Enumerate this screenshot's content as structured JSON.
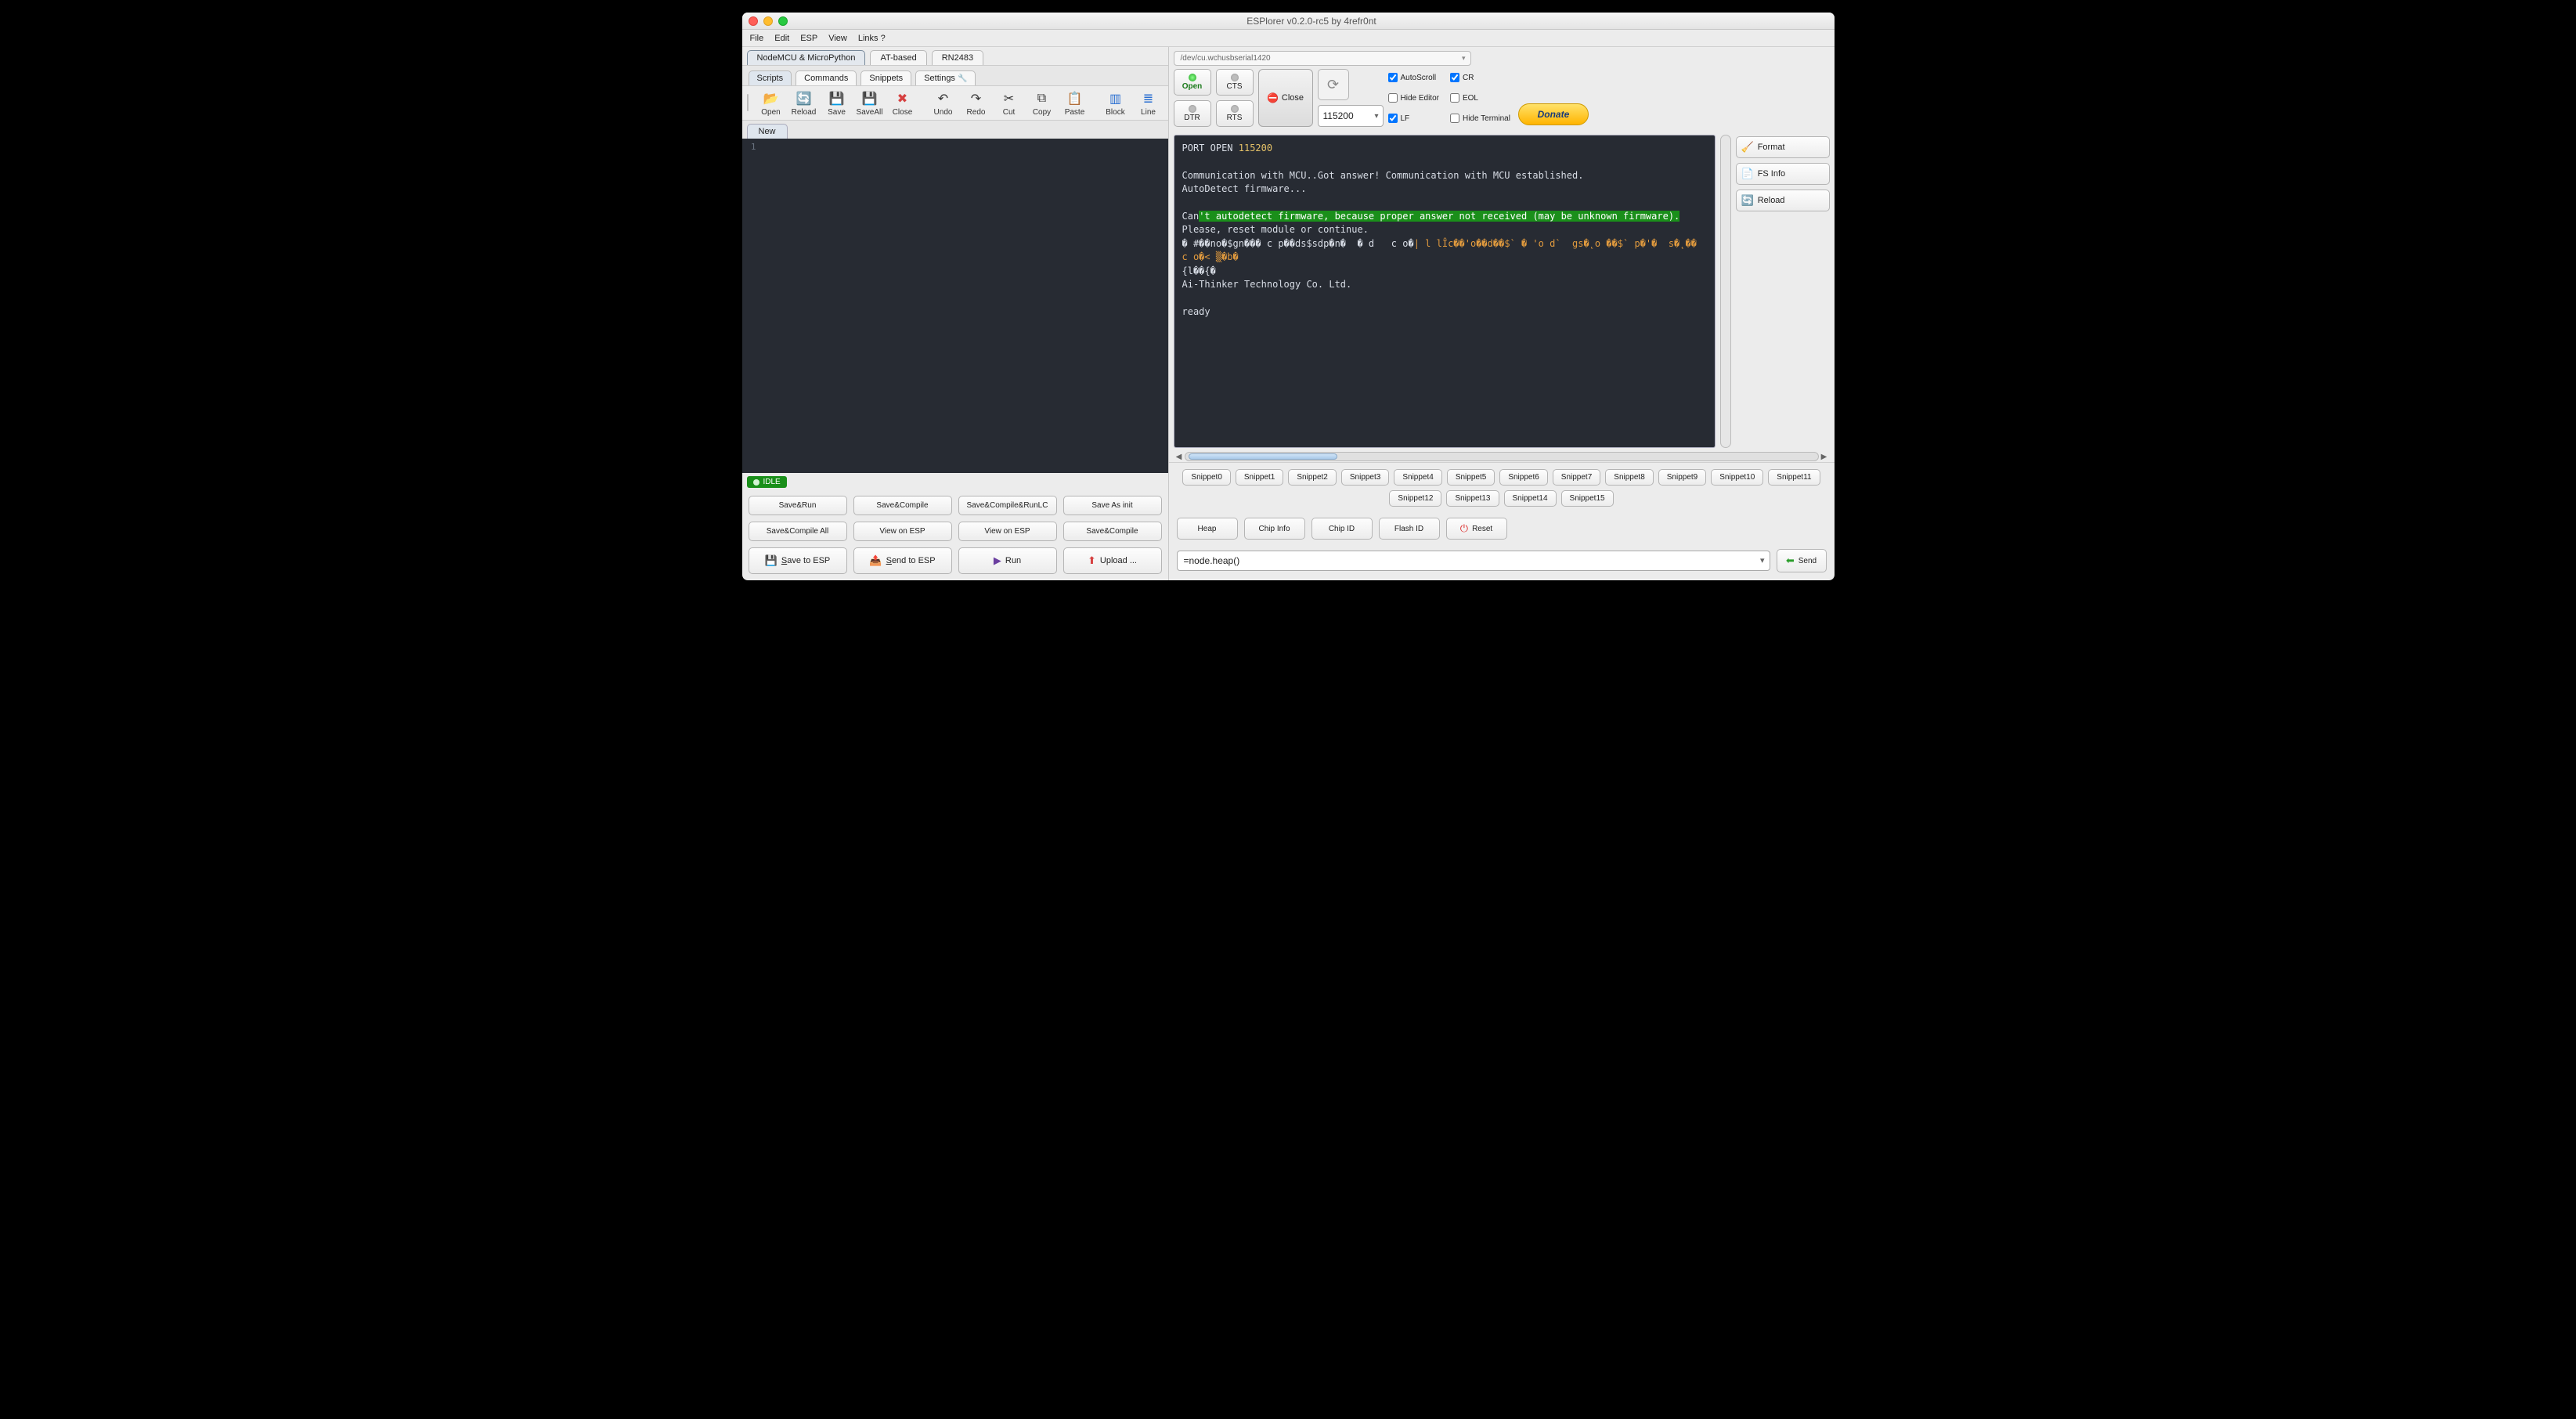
{
  "window": {
    "title": "ESPlorer v0.2.0-rc5 by 4refr0nt"
  },
  "menu": [
    "File",
    "Edit",
    "ESP",
    "View",
    "Links ?"
  ],
  "left": {
    "device_tabs": [
      "NodeMCU & MicroPython",
      "AT-based",
      "RN2483"
    ],
    "device_tab_active": 0,
    "mode_tabs": [
      "Scripts",
      "Commands",
      "Snippets",
      "Settings"
    ],
    "mode_tab_active": 0,
    "toolbar": [
      {
        "label": "Open",
        "icon": "📂",
        "cls": "ico-orange"
      },
      {
        "label": "Reload",
        "icon": "🔄",
        "cls": "ico-blue"
      },
      {
        "label": "Save",
        "icon": "💾",
        "cls": ""
      },
      {
        "label": "SaveAll",
        "icon": "💾",
        "cls": ""
      },
      {
        "label": "Close",
        "icon": "✖",
        "cls": "ico-red"
      },
      {
        "label": "Undo",
        "icon": "↶",
        "cls": ""
      },
      {
        "label": "Redo",
        "icon": "↷",
        "cls": ""
      },
      {
        "label": "Cut",
        "icon": "✂",
        "cls": ""
      },
      {
        "label": "Copy",
        "icon": "⧉",
        "cls": ""
      },
      {
        "label": "Paste",
        "icon": "📋",
        "cls": ""
      },
      {
        "label": "Block",
        "icon": "▥",
        "cls": "ico-blue"
      },
      {
        "label": "Line",
        "icon": "≣",
        "cls": "ico-blue"
      }
    ],
    "file_tab": "New",
    "gutter_line": "1",
    "status": "IDLE",
    "action_grid": [
      "Save&Run",
      "Save&Compile",
      "Save&Compile&RunLC",
      "Save As init",
      "Save&Compile All",
      "View on ESP",
      "View on ESP",
      "Save&Compile"
    ],
    "bottom_buttons": [
      {
        "label": "Save to ESP",
        "icon": "💾",
        "cls": "ico-green",
        "underline": "S"
      },
      {
        "label": "Send to ESP",
        "icon": "📤",
        "cls": "ico-green",
        "underline": "S"
      },
      {
        "label": "Run",
        "icon": "▶",
        "cls": "ico-purple"
      },
      {
        "label": "Upload ...",
        "icon": "⬆",
        "cls": "ico-red"
      }
    ]
  },
  "right": {
    "port": "/dev/cu.wchusbserial1420",
    "conn": {
      "open": "Open",
      "cts": "CTS",
      "dtr": "DTR",
      "rts": "RTS",
      "close": "Close"
    },
    "baud": "115200",
    "checks": {
      "autoscroll": {
        "label": "AutoScroll",
        "checked": true
      },
      "eol": {
        "label": "EOL",
        "checked": false
      },
      "cr": {
        "label": "CR",
        "checked": true
      },
      "lf": {
        "label": "LF",
        "checked": true
      },
      "hide_editor": {
        "label": "Hide Editor",
        "checked": false
      },
      "hide_terminal": {
        "label": "Hide Terminal",
        "checked": false
      }
    },
    "donate": "Donate",
    "terminal": {
      "port_open_prefix": "PORT OPEN ",
      "port_open_baud": "115200",
      "line_comm": "Communication with MCU..Got answer! Communication with MCU established.",
      "line_autodetect": "AutoDetect firmware...",
      "warn_prefix": "Can",
      "warn_hl": "'t autodetect firmware, because proper answer not received (may be unknown firmware).",
      "line_reset": "Please, reset module or continue.",
      "garbage_a": "� #��no�$gn��� c p��ds$sdp�n�  � d   c o�",
      "garbage_b": "| l lÎc��'o��d��$` � 'o d`  gs�˛o ��$` p�'�  s�˛��  c o�< ▒�b�",
      "garbage_c": "{l��{�",
      "vendor": "Ai-Thinker Technology Co. Ltd.",
      "ready": "ready"
    },
    "side_actions": [
      {
        "label": "Format",
        "icon": "🧹",
        "cls": "ico-orange"
      },
      {
        "label": "FS Info",
        "icon": "📄",
        "cls": "ico-orange"
      },
      {
        "label": "Reload",
        "icon": "🔄",
        "cls": "ico-blue"
      }
    ],
    "snippets_row1": [
      "Snippet0",
      "Snippet1",
      "Snippet2",
      "Snippet3",
      "Snippet4",
      "Snippet5",
      "Snippet6",
      "Snippet7",
      "Snippet8",
      "Snippet9",
      "Snippet10",
      "Snippet11",
      "Snippet12"
    ],
    "snippets_row2": [
      "Snippet13",
      "Snippet14",
      "Snippet15"
    ],
    "cmd_buttons": [
      "Heap",
      "Chip Info",
      "Chip ID",
      "Flash ID"
    ],
    "reset": "Reset",
    "send_input": "=node.heap()",
    "send_label": "Send"
  }
}
